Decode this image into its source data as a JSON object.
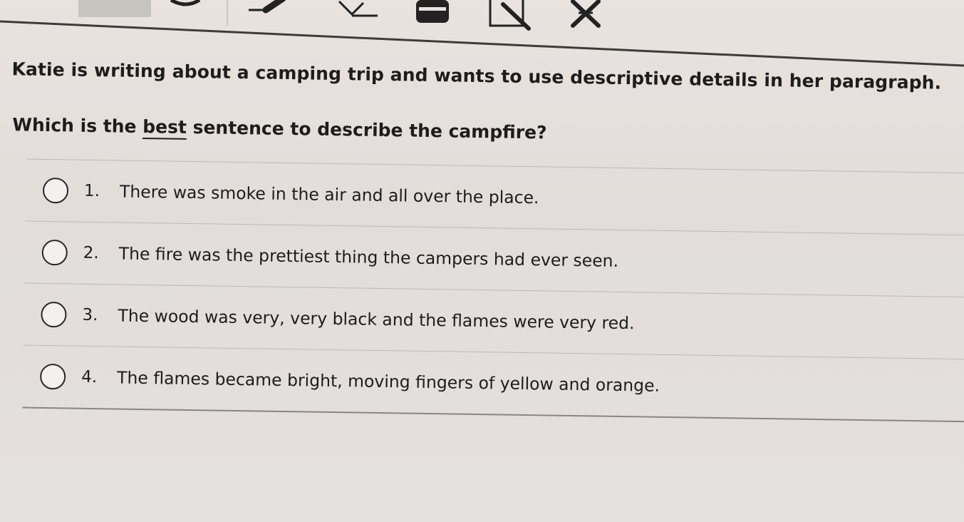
{
  "toolbar": {
    "tools": [
      {
        "icon": "tool-block-icon"
      },
      {
        "icon": "pointer-icon"
      },
      {
        "icon": "pencil-icon"
      },
      {
        "icon": "eraser-icon"
      },
      {
        "icon": "line-reader-icon"
      },
      {
        "icon": "notepad-icon"
      },
      {
        "icon": "answer-eliminator-icon"
      }
    ]
  },
  "question": {
    "prompt": "Katie is writing about a camping trip and wants to use descriptive details in her paragraph.",
    "stem_before": "Which is the ",
    "stem_emphasis": "best",
    "stem_after": " sentence to describe the campfire?"
  },
  "choices": [
    {
      "number": "1.",
      "text": "There was smoke in the air and all over the place."
    },
    {
      "number": "2.",
      "text": "The fire was the prettiest thing the campers had ever seen."
    },
    {
      "number": "3.",
      "text": "The wood was very, very black and the flames were very red."
    },
    {
      "number": "4.",
      "text": "The flames became bright, moving fingers of yellow and orange."
    }
  ]
}
